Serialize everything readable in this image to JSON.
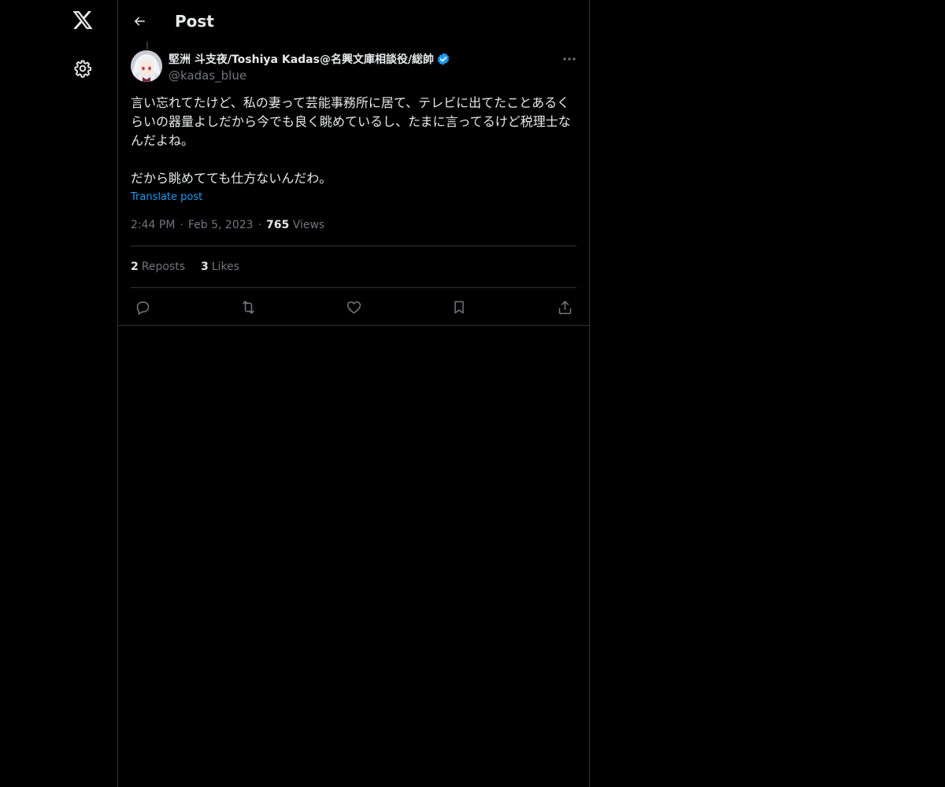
{
  "nav": {
    "logo_icon": "x-logo-icon",
    "settings_icon": "gear-icon"
  },
  "header": {
    "title": "Post",
    "back_icon": "arrow-left-icon"
  },
  "post": {
    "author_name": "堅洲 斗支夜/Toshiya Kadas@名興文庫相談役/総帥",
    "handle": "@kadas_blue",
    "verified": true,
    "text": "言い忘れてたけど、私の妻って芸能事務所に居て、テレビに出てたことあるくらいの器量よしだから今でも良く眺めているし、たまに言ってるけど税理士なんだよね。\n\nだから眺めてても仕方ないんだわ。",
    "translate_label": "Translate post",
    "time": "2:44 PM",
    "date": "Feb 5, 2023",
    "views_count": "765",
    "views_label": "Views",
    "reposts_count": "2",
    "reposts_label": "Reposts",
    "likes_count": "3",
    "likes_label": "Likes"
  },
  "actions": [
    "reply-icon",
    "repost-icon",
    "like-icon",
    "bookmark-icon",
    "share-icon"
  ],
  "colors": {
    "background": "#000000",
    "text": "#e7e9ea",
    "muted": "#71767b",
    "accent": "#1d9bf0",
    "border": "#2f3336"
  }
}
